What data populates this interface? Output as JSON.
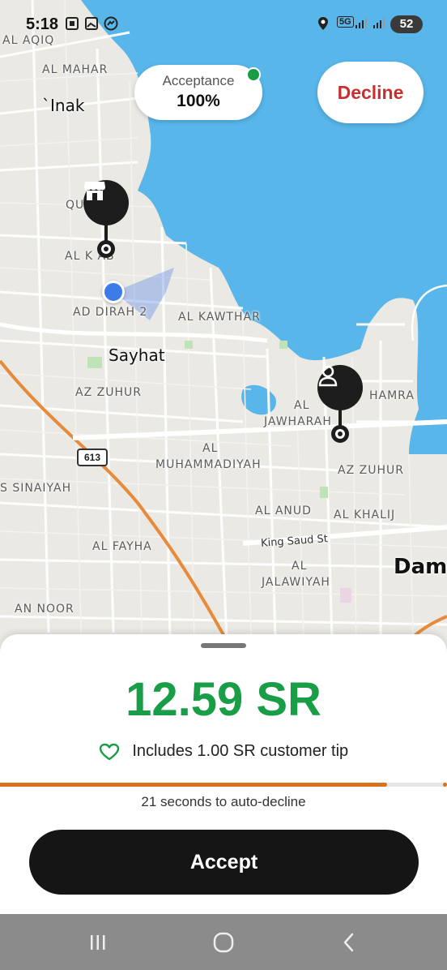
{
  "status_bar": {
    "time": "5:18",
    "battery": "52",
    "network": "5G"
  },
  "acceptance": {
    "label": "Acceptance",
    "value": "100%",
    "indicator_color": "#1c9b45"
  },
  "decline_button": {
    "label": "Decline",
    "color": "#c8302f"
  },
  "map": {
    "labels": {
      "al_aqiq": "AL AQIQ",
      "al_mahar": "AL MAHAR",
      "inak": "`Inak",
      "qudaih": "QU        H",
      "al_khabab": "AL K       AB",
      "ad_dirah": "AD DIRAH 2",
      "al_kawthar": "AL KAWTHAR",
      "sayhat": "Sayhat",
      "az_zuhur_w": "AZ ZUHUR",
      "al_jawharah_1": "AL",
      "al_jawharah_2": "JAWHARAH",
      "al_hamra": "HAMRA",
      "al_muhammadiyah_1": "AL",
      "al_muhammadiyah_2": "MUHAMMADIYAH",
      "az_zuhur_e": "AZ ZUHUR",
      "sinaiyah": "S SINAIYAH",
      "al_anud": "AL ANUD",
      "al_khalij": "AL KHALIJ",
      "king_saud": "King Saud St",
      "al_fayha": "AL FAYHA",
      "al_jalawiyah_1": "AL",
      "al_jalawiyah_2": "JALAWIYAH",
      "dammam": "Damm",
      "an_noor": "AN NOOR",
      "route_613": "613"
    },
    "pickup_icon": "store-icon",
    "dropoff_icon": "person-icon"
  },
  "offer": {
    "fare": "12.59 SR",
    "tip_text": "Includes 1.00 SR customer tip",
    "tip_icon": "heart-icon",
    "fare_color": "#1a9d47",
    "timer_text": "21 seconds to auto-decline",
    "timer_progress": 0.866,
    "progress_color": "#d9721c",
    "accept_label": "Accept"
  },
  "nav_bar": {
    "recents_icon": "recents-icon",
    "home_icon": "home-icon",
    "back_icon": "back-icon"
  }
}
